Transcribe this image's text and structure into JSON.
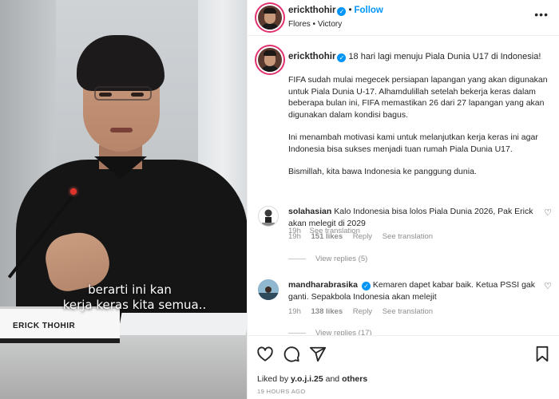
{
  "media": {
    "subtitle_line1": "berarti ini kan",
    "subtitle_line2": "kerja keras kita semua..",
    "nameplate": "ERICK THOHIR"
  },
  "header": {
    "username": "erickthohir",
    "follow_label": "Follow",
    "location": "Flores • Victory",
    "more_icon": "more-horizontal-icon"
  },
  "post": {
    "username": "erickthohir",
    "title": "18 hari lagi menuju Piala Dunia U17 di Indonesia!",
    "paragraphs": [
      "FIFA sudah mulai megecek persiapan lapangan yang akan digunakan untuk Piala Dunia U-17. Alhamdulillah setelah bekerja keras dalam beberapa bulan ini, FIFA memastikan 26 dari 27 lapangan yang akan digunakan dalam kondisi bagus.",
      "Ini menambah motivasi kami untuk melanjutkan kerja keras ini agar Indonesia bisa sukses menjadi tuan rumah Piala Dunia U17.",
      "Bismillah, kita bawa Indonesia ke panggung dunia."
    ],
    "age": "19h",
    "see_translation": "See translation"
  },
  "comments": [
    {
      "username": "solahasian",
      "text": "Kalo Indonesia bisa lolos Piala Dunia 2026, Pak Erick akan melegit di 2029",
      "age": "19h",
      "likes": "151 likes",
      "reply": "Reply",
      "see_translation": "See translation",
      "view_replies": "View replies (5)"
    },
    {
      "username": "mandharabrasika",
      "text": "Kemaren dapet kabar baik. Ketua PSSI gak ganti. Sepakbola Indonesia akan melejit",
      "age": "19h",
      "likes": "138 likes",
      "reply": "Reply",
      "see_translation": "See translation",
      "view_replies": "View replies (17)"
    }
  ],
  "footer": {
    "liked_prefix": "Liked by",
    "liked_user": "y.o.j.i.25",
    "liked_and": "and",
    "liked_others": "others",
    "timestamp": "19 HOURS AGO"
  },
  "colors": {
    "accent": "#0095f6",
    "text": "#262626",
    "secondary": "#8e8e8e"
  }
}
